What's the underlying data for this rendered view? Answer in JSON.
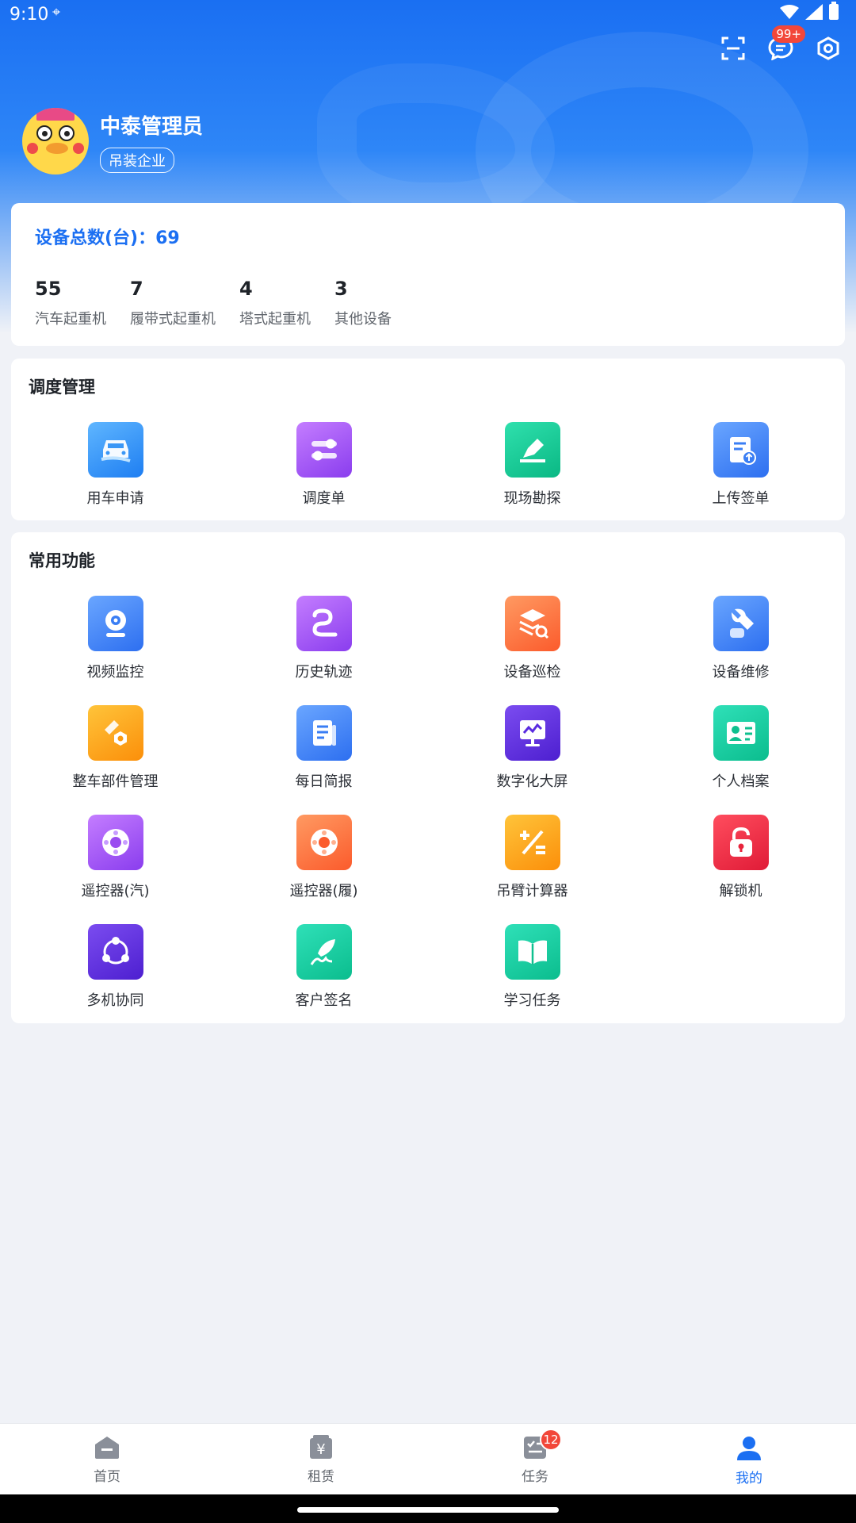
{
  "status_bar": {
    "time": "9:10"
  },
  "header": {
    "message_badge": "99+",
    "user_name": "中泰管理员",
    "user_tag": "吊装企业"
  },
  "device_summary": {
    "total_label": "设备总数(台)：69",
    "stats": [
      {
        "value": "55",
        "label": "汽车起重机"
      },
      {
        "value": "7",
        "label": "履带式起重机"
      },
      {
        "value": "4",
        "label": "塔式起重机"
      },
      {
        "value": "3",
        "label": "其他设备"
      }
    ]
  },
  "dispatch": {
    "title": "调度管理",
    "items": [
      {
        "label": "用车申请",
        "icon": "car-request-icon",
        "color": "#1e7ef2"
      },
      {
        "label": "调度单",
        "icon": "dispatch-slider-icon",
        "color": "#8a3dee"
      },
      {
        "label": "现场勘探",
        "icon": "site-survey-icon",
        "color": "#0ab884"
      },
      {
        "label": "上传签单",
        "icon": "upload-document-icon",
        "color": "#2d6ff0"
      }
    ]
  },
  "common": {
    "title": "常用功能",
    "items": [
      {
        "label": "视频监控",
        "icon": "camera-icon"
      },
      {
        "label": "历史轨迹",
        "icon": "route-icon"
      },
      {
        "label": "设备巡检",
        "icon": "inspection-icon"
      },
      {
        "label": "设备维修",
        "icon": "wrench-icon"
      },
      {
        "label": "整车部件管理",
        "icon": "parts-icon"
      },
      {
        "label": "每日简报",
        "icon": "report-icon"
      },
      {
        "label": "数字化大屏",
        "icon": "monitor-icon"
      },
      {
        "label": "个人档案",
        "icon": "profile-card-icon"
      },
      {
        "label": "遥控器(汽)",
        "icon": "remote-control-icon"
      },
      {
        "label": "遥控器(履)",
        "icon": "remote-control-icon"
      },
      {
        "label": "吊臂计算器",
        "icon": "calculator-icon"
      },
      {
        "label": "解锁机",
        "icon": "unlock-icon"
      },
      {
        "label": "多机协同",
        "icon": "collaboration-icon"
      },
      {
        "label": "客户签名",
        "icon": "signature-icon"
      },
      {
        "label": "学习任务",
        "icon": "book-icon"
      }
    ]
  },
  "tabbar": {
    "items": [
      {
        "label": "首页",
        "icon": "home-icon"
      },
      {
        "label": "租赁",
        "icon": "rental-icon"
      },
      {
        "label": "任务",
        "icon": "task-icon",
        "badge": "12"
      },
      {
        "label": "我的",
        "icon": "user-icon",
        "active": true
      }
    ]
  },
  "colors": {
    "accent": "#1b6ff2",
    "badge": "#f2473a"
  }
}
